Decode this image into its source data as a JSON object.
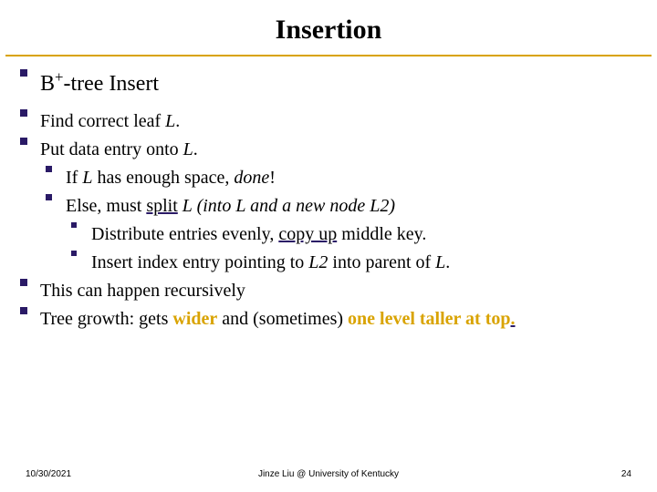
{
  "title": "Insertion",
  "heading_parts": {
    "b": "B",
    "plus": "+",
    "rest": "-tree Insert"
  },
  "body": {
    "find_leaf": {
      "pre": "Find correct leaf ",
      "L": "L",
      "post": "."
    },
    "put_entry": {
      "pre": "Put data entry onto ",
      "L": "L",
      "post": "."
    },
    "if_space": {
      "pre": "If ",
      "L": "L",
      "mid": " has enough space, ",
      "done": "done",
      "post": "!"
    },
    "else_split": {
      "pre": "Else, must ",
      "split": "split",
      "mid1": "  ",
      "L": "L",
      "mid2": " (into ",
      "L2a": "L",
      "mid3": " and a new node ",
      "L2b": "L",
      "num2a": "2",
      "post": ")"
    },
    "distribute": {
      "pre": "Distribute entries evenly, ",
      "copyup": "copy up",
      "post": " middle key."
    },
    "insert_index": {
      "pre": "Insert index entry pointing to ",
      "L": "L",
      "num2": "2",
      "mid": " into parent of ",
      "L2": "L",
      "post": "."
    },
    "recursive": "This can happen recursively",
    "growth": {
      "pre": "Tree growth: gets ",
      "wider": "wider",
      "mid": " and (sometimes) ",
      "taller": "one level taller at top",
      "dotu": "."
    }
  },
  "footer": {
    "date": "10/30/2021",
    "center": "Jinze Liu @ University of Kentucky",
    "page": "24"
  }
}
